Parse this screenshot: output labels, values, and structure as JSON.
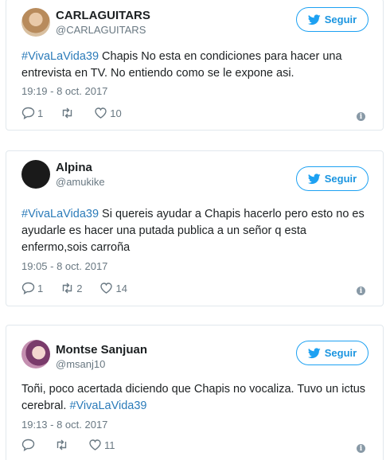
{
  "follow_label": "Seguir",
  "tweets": [
    {
      "name": "CARLAGUITARS",
      "handle": "@CARLAGUITARS",
      "hashtag": "#VivaLaVida39",
      "text_after": " Chapis No esta en condiciones para hacer una entrevista en TV. No entiendo como se le expone asi.",
      "time": "19:19 - 8 oct. 2017",
      "replies": "1",
      "retweets": "",
      "likes": "10"
    },
    {
      "name": "Alpina",
      "handle": "@amukike",
      "hashtag": "#VivaLaVida39",
      "text_after": " Si quereis ayudar a Chapis hacerlo pero esto no es ayudarle es hacer una putada publica a un señor q esta enfermo,sois carroña",
      "time": "19:05 - 8 oct. 2017",
      "replies": "1",
      "retweets": "2",
      "likes": "14"
    },
    {
      "name": "Montse Sanjuan",
      "handle": "@msanj10",
      "text_before": "Toñi, poco acertada diciendo que Chapis no vocaliza. Tuvo un ictus cerebral. ",
      "hashtag": "#VivaLaVida39",
      "time": "19:13 - 8 oct. 2017",
      "replies": "",
      "retweets": "",
      "likes": "11"
    }
  ],
  "icons": {
    "follow": "twitter-bird-icon",
    "reply": "reply-icon",
    "retweet": "retweet-icon",
    "like": "heart-icon",
    "info": "info-icon"
  },
  "colors": {
    "accent": "#1da1f2",
    "hashtag": "#2b7bb9",
    "muted": "#697882",
    "border": "#e1e8ed"
  }
}
